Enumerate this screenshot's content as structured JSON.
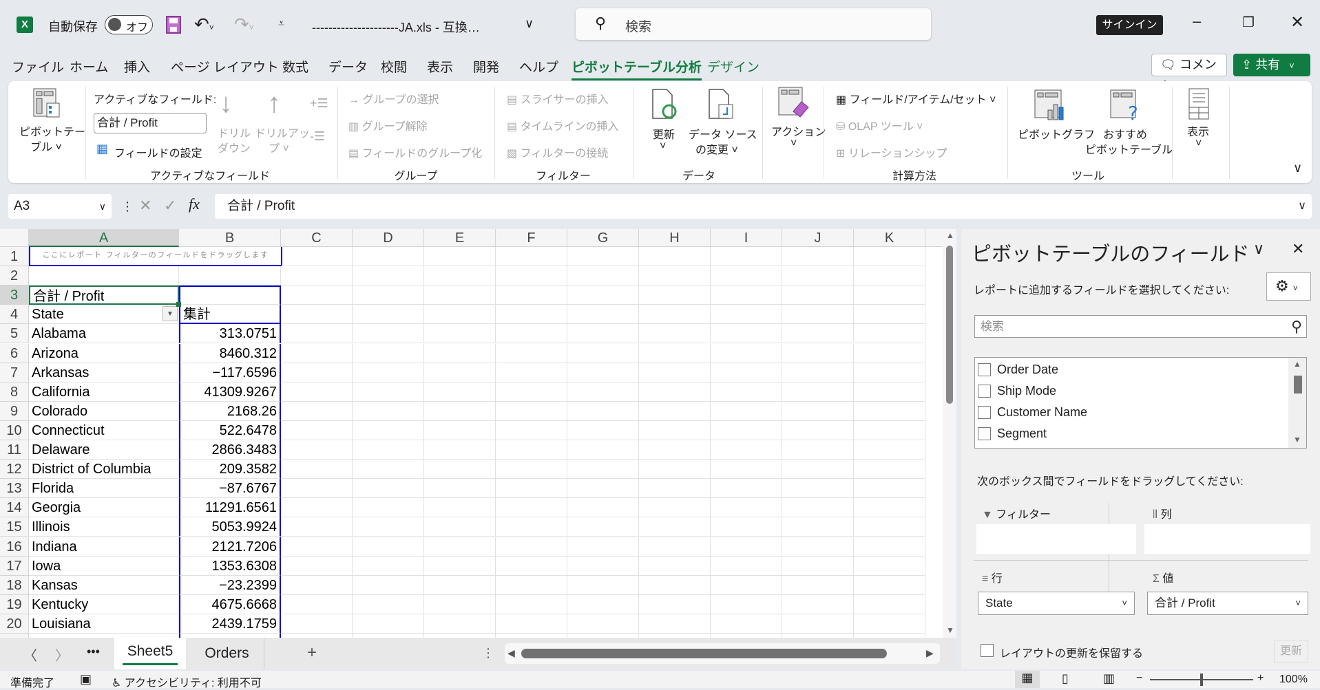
{
  "titlebar": {
    "autosave_label": "自動保存",
    "autosave_state": "オフ",
    "doc_title": "---------------------JA.xls  -  互換…",
    "search_placeholder": "検索",
    "signin": "サインイン"
  },
  "menu": {
    "items": [
      "ファイル",
      "ホーム",
      "挿入",
      "ページ レイアウト",
      "数式",
      "データ",
      "校閲",
      "表示",
      "開発",
      "ヘルプ",
      "ピボットテーブル分析",
      "デザイン"
    ],
    "active_index": 10,
    "comment": "コメント",
    "share": "共有"
  },
  "ribbon": {
    "pivot_table": [
      "ピボットテー",
      "ブル ˅"
    ],
    "active_field_label": "アクティブなフィールド:",
    "active_field_value": "合計 / Profit",
    "field_settings": "フィールドの設定",
    "drill_down": [
      "ドリル",
      "ダウン"
    ],
    "drill_up": [
      "ドリルアッ",
      "プ ˅"
    ],
    "group_active_field": "アクティブなフィールド",
    "group_select": "グループの選択",
    "ungroup": "グループ解除",
    "group_field": "フィールドのグループ化",
    "group_group": "グループ",
    "insert_slicer": "スライサーの挿入",
    "insert_timeline": "タイムラインの挿入",
    "filter_connections": "フィルターの接続",
    "group_filter": "フィルター",
    "refresh": [
      "更新",
      "˅"
    ],
    "change_source": [
      "データ ソース",
      "の変更 ˅"
    ],
    "group_data": "データ",
    "action": [
      "アクション",
      "˅"
    ],
    "fields_items_sets": "フィールド/アイテム/セット ˅",
    "olap_tools": "OLAP ツール ˅",
    "relationships": "リレーションシップ",
    "group_calc": "計算方法",
    "pivot_chart": "ピボットグラフ",
    "recommended": [
      "おすすめ",
      "ピボットテーブル"
    ],
    "group_tools": "ツール",
    "show": [
      "表示",
      "˅"
    ]
  },
  "formula": {
    "name_box": "A3",
    "content": "合計 / Profit"
  },
  "grid": {
    "columns": [
      "A",
      "B",
      "C",
      "D",
      "E",
      "F",
      "G",
      "H",
      "I",
      "J",
      "K"
    ],
    "filter_hint": "ここにレポート フィルターのフィールドをドラッグします",
    "header_label": "合計 / Profit",
    "row_label": "State",
    "value_label": "集計",
    "rows": [
      [
        "Alabama",
        "313.0751"
      ],
      [
        "Arizona",
        "8460.312"
      ],
      [
        "Arkansas",
        "−117.6596"
      ],
      [
        "California",
        "41309.9267"
      ],
      [
        "Colorado",
        "2168.26"
      ],
      [
        "Connecticut",
        "522.6478"
      ],
      [
        "Delaware",
        "2866.3483"
      ],
      [
        "District of Columbia",
        "209.3582"
      ],
      [
        "Florida",
        "−87.6767"
      ],
      [
        "Georgia",
        "11291.6561"
      ],
      [
        "Illinois",
        "5053.9924"
      ],
      [
        "Indiana",
        "2121.7206"
      ],
      [
        "Iowa",
        "1353.6308"
      ],
      [
        "Kansas",
        "−23.2399"
      ],
      [
        "Kentucky",
        "4675.6668"
      ],
      [
        "Louisiana",
        "2439.1759"
      ]
    ]
  },
  "sheets": {
    "tabs": [
      "Sheet5",
      "Orders"
    ],
    "active": "Sheet5"
  },
  "panel": {
    "title": "ピボットテーブルのフィールド",
    "instruction": "レポートに追加するフィールドを選択してください:",
    "search_placeholder": "検索",
    "fields": [
      "Order Date",
      "Ship Mode",
      "Customer Name",
      "Segment"
    ],
    "drag_hint": "次のボックス間でフィールドをドラッグしてください:",
    "filters": "フィルター",
    "columns": "列",
    "rows": "行",
    "values": "値",
    "row_value": "State",
    "value_value": "合計 / Profit",
    "defer": "レイアウトの更新を保留する",
    "update": "更新"
  },
  "status": {
    "ready": "準備完了",
    "accessibility": "アクセシビリティ: 利用不可",
    "zoom": "100%"
  },
  "colors": {
    "accent": "#107c41",
    "pivot_border": "#0000cc",
    "selection": "#217346"
  }
}
